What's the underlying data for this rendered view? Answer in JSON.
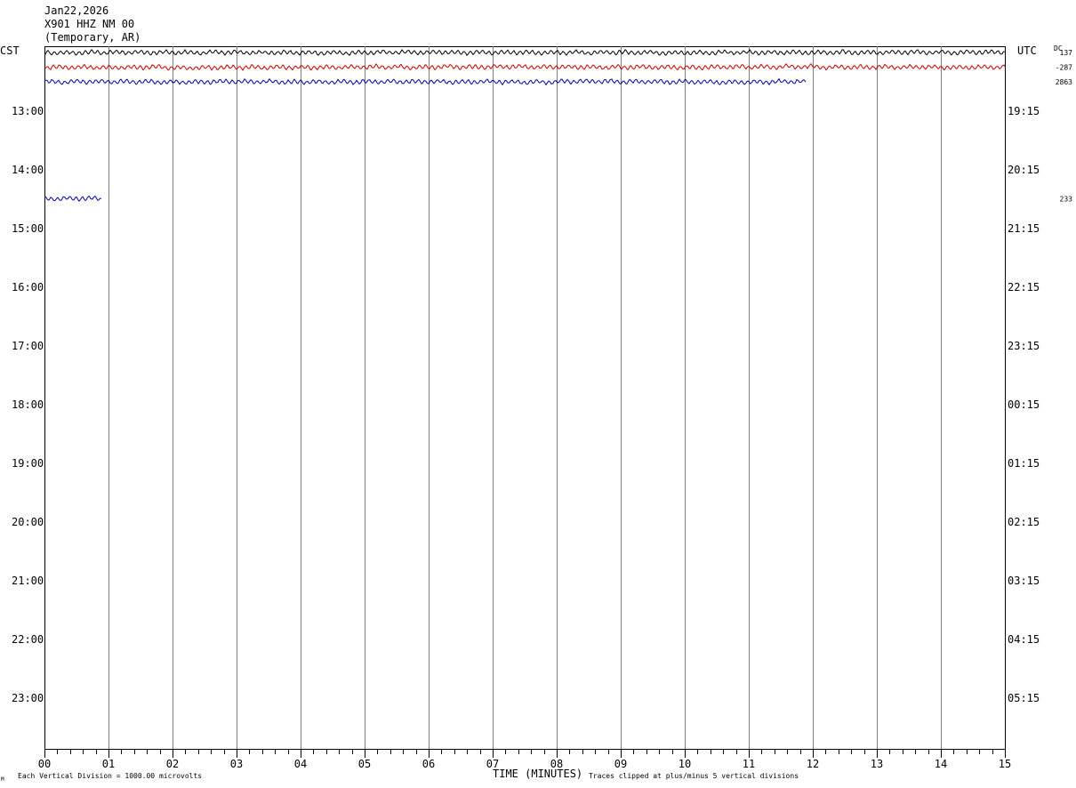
{
  "header": {
    "date": "Jan22,2026",
    "station": "X901 HHZ NM 00",
    "location": "(Temporary, AR)"
  },
  "chart_data": {
    "type": "line",
    "subtype": "helicorder",
    "left_axis_title": "CST",
    "right_axis_title": "UTC",
    "dc_label": "DC",
    "xlabel": "TIME (MINUTES)",
    "xlim": [
      0,
      15
    ],
    "x_ticks": [
      "00",
      "01",
      "02",
      "03",
      "04",
      "05",
      "06",
      "07",
      "08",
      "09",
      "10",
      "11",
      "12",
      "13",
      "14",
      "15"
    ],
    "left_hour_labels": [
      "13:00",
      "14:00",
      "15:00",
      "16:00",
      "17:00",
      "18:00",
      "19:00",
      "20:00",
      "21:00",
      "22:00",
      "23:00"
    ],
    "right_hour_labels": [
      "19:15",
      "20:15",
      "21:15",
      "22:15",
      "23:15",
      "00:15",
      "01:15",
      "02:15",
      "03:15",
      "04:15",
      "05:15"
    ],
    "footer_left": "Each Vertical Division = 1000.00 microvolts",
    "footer_right": "Traces clipped at plus/minus 5 vertical divisions",
    "footer_mark": "M",
    "grid": true,
    "rows_visible": 45,
    "series": [
      {
        "row": 0,
        "color": "#000000",
        "x_end": 15,
        "dc_value": "137"
      },
      {
        "row": 1,
        "color": "#cc0000",
        "x_end": 15,
        "dc_value": "-287"
      },
      {
        "row": 2,
        "color": "#0000aa",
        "x_end": 11.9,
        "dc_value": "2863"
      },
      {
        "row": 10,
        "color": "#0000aa",
        "x_end": 0.9,
        "dc_value": "233"
      }
    ]
  }
}
